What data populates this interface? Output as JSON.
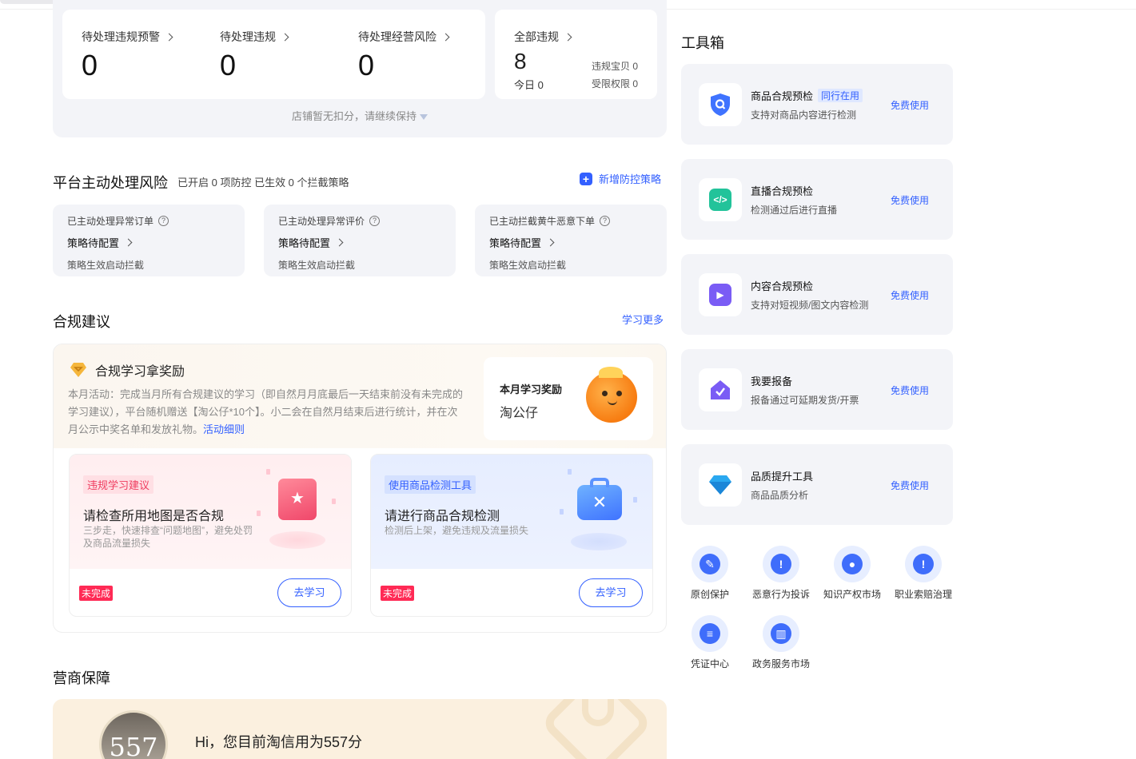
{
  "violations": {
    "items": [
      {
        "label": "待处理违规预警",
        "count": "0"
      },
      {
        "label": "待处理违规",
        "count": "0"
      },
      {
        "label": "待处理经营风险",
        "count": "0"
      }
    ],
    "all": {
      "label": "全部违规",
      "count": "8",
      "today": "今日 0",
      "bao": "违规宝贝 0",
      "limit": "受限权限 0"
    },
    "note": "店铺暂无扣分，请继续保持"
  },
  "risk": {
    "title": "平台主动处理风险",
    "subtitle": "已开启 0 项防控 已生效 0 个拦截策略",
    "add_label": "新增防控策略",
    "cards": [
      {
        "title": "已主动处理异常订单",
        "status": "策略待配置",
        "sub": "策略生效启动拦截"
      },
      {
        "title": "已主动处理异常评价",
        "status": "策略待配置",
        "sub": "策略生效启动拦截"
      },
      {
        "title": "已主动拦截黄牛恶意下单",
        "status": "策略待配置",
        "sub": "策略生效启动拦截"
      }
    ]
  },
  "suggestion": {
    "title": "合规建议",
    "more": "学习更多",
    "reward_title": "合规学习拿奖励",
    "reward_desc": "本月活动：完成当月所有合规建议的学习（即自然月月底最后一天结束前没有未完成的学习建议），平台随机赠送【淘公仔*10个】。小二会在自然月结束后进行统计，并在次月公示中奖名单和发放礼物。",
    "reward_link": "活动细则",
    "reward_card_title": "本月学习奖励",
    "reward_card_prize": "淘公仔",
    "tasks": [
      {
        "tag": "违规学习建议",
        "heading": "请检查所用地图是否合规",
        "desc": "三步走，快速排查“问题地图”，避免处罚及商品流量损失",
        "status": "未完成",
        "button": "去学习"
      },
      {
        "tag": "使用商品检测工具",
        "heading": "请进行商品合规检测",
        "desc": "检测后上架，避免违规及流量损失",
        "status": "未完成",
        "button": "去学习"
      }
    ]
  },
  "guarantee": {
    "title": "营商保障",
    "score": "557",
    "text": "Hi，您目前淘信用为557分"
  },
  "toolbox": {
    "title": "工具箱",
    "tools": [
      {
        "name": "商品合规预检",
        "badge": "同行在用",
        "desc": "支持对商品内容进行检测",
        "action": "免费使用",
        "icon": "shield-search-icon",
        "color": "#3f73ff"
      },
      {
        "name": "直播合规预检",
        "badge": "",
        "desc": "检测通过后进行直播",
        "action": "免费使用",
        "icon": "code-icon",
        "color": "#22c39a"
      },
      {
        "name": "内容合规预检",
        "badge": "",
        "desc": "支持对短视频/图文内容检测",
        "action": "免费使用",
        "icon": "video-icon",
        "color": "#7a5cf5"
      },
      {
        "name": "我要报备",
        "badge": "",
        "desc": "报备通过可延期发货/开票",
        "action": "免费使用",
        "icon": "house-check-icon",
        "color": "#7a5cf5"
      },
      {
        "name": "品质提升工具",
        "badge": "",
        "desc": "商品品质分析",
        "action": "免费使用",
        "icon": "diamond-icon",
        "color": "#2aa8f0"
      }
    ],
    "quick": [
      {
        "label": "原创保护",
        "icon": "pen-icon",
        "glyph": "✎"
      },
      {
        "label": "恶意行为投诉",
        "icon": "alert-icon",
        "glyph": "!"
      },
      {
        "label": "知识产权市场",
        "icon": "bulb-icon",
        "glyph": "●"
      },
      {
        "label": "职业索赔治理",
        "icon": "alert-icon",
        "glyph": "!"
      },
      {
        "label": "凭证中心",
        "icon": "ticket-icon",
        "glyph": "≡"
      },
      {
        "label": "政务服务市场",
        "icon": "building-icon",
        "glyph": "▥"
      }
    ]
  }
}
